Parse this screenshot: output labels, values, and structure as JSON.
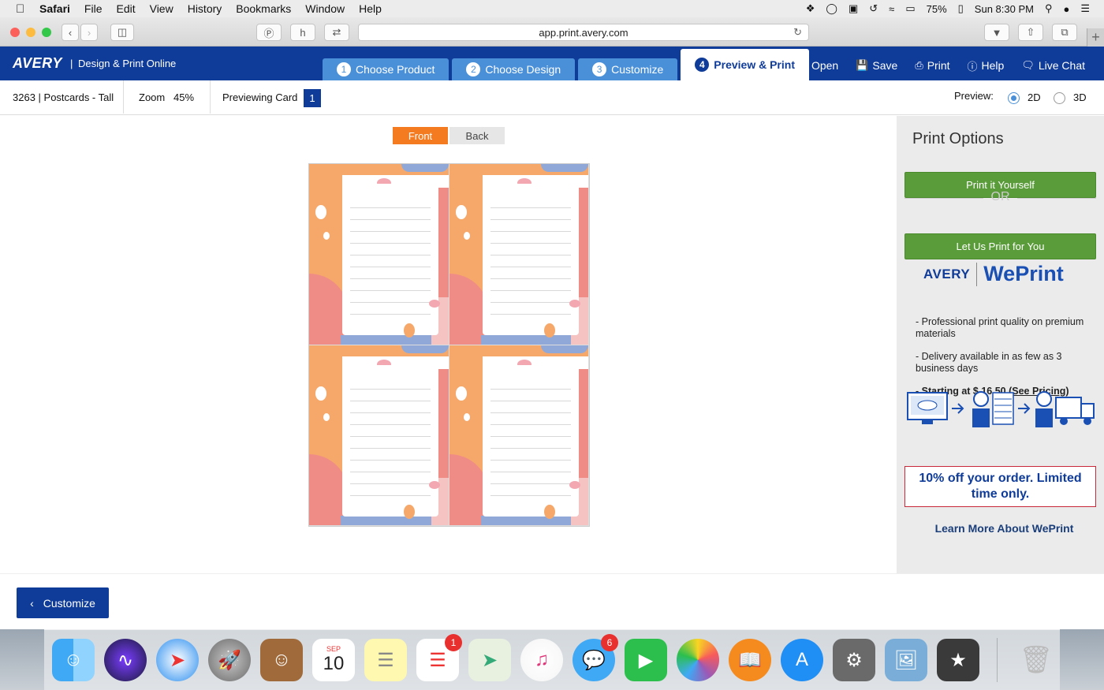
{
  "menubar": {
    "app": "Safari",
    "items": [
      "File",
      "Edit",
      "View",
      "History",
      "Bookmarks",
      "Window",
      "Help"
    ],
    "battery": "75%",
    "clock": "Sun 8:30 PM"
  },
  "browser": {
    "url": "app.print.avery.com"
  },
  "header": {
    "logo": "AVERY",
    "separator": "|",
    "tagline": "Design & Print Online",
    "steps": [
      {
        "num": "1",
        "label": "Choose Product"
      },
      {
        "num": "2",
        "label": "Choose Design"
      },
      {
        "num": "3",
        "label": "Customize"
      },
      {
        "num": "4",
        "label": "Preview & Print"
      }
    ],
    "links": {
      "open": "Open",
      "save": "Save",
      "print": "Print",
      "help": "Help",
      "chat": "Live Chat"
    }
  },
  "subbar": {
    "product": "3263 | Postcards - Tall",
    "zoom_label": "Zoom",
    "zoom_value": "45%",
    "previewing_label": "Previewing Card",
    "card_number": "1",
    "preview_label": "Preview:",
    "mode_2d": "2D",
    "mode_3d": "3D"
  },
  "canvas": {
    "front_tab": "Front",
    "back_tab": "Back"
  },
  "panel": {
    "title": "Print Options",
    "print_yourself": "Print it Yourself",
    "or": "OR",
    "let_us_print": "Let Us Print for You",
    "brand_avery": "AVERY",
    "brand_weprint": "WePrint",
    "bullet1": "- Professional print quality on premium materials",
    "bullet2": "- Delivery available in as few as 3 business days",
    "pricing_prefix": "- Starting at $ 16.50 (",
    "pricing_link": "See Pricing",
    "pricing_suffix": ")",
    "promo": "10% off your order. Limited time only.",
    "learn_more": "Learn More About WePrint"
  },
  "footer": {
    "back_button": "Customize"
  },
  "dock": {
    "calendar_month": "SEP",
    "calendar_day": "10",
    "reminders_badge": "1",
    "messages_badge": "6"
  }
}
